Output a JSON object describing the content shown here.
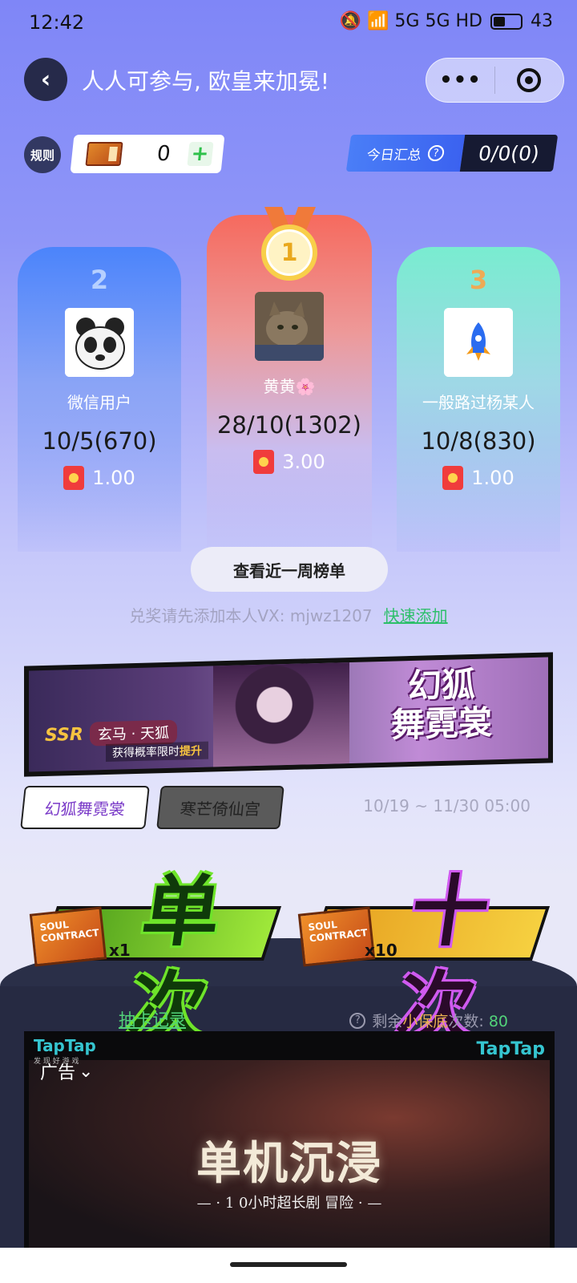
{
  "status_bar": {
    "time": "12:42",
    "indicators": "🔕 📶 5G 5G HD",
    "battery": "43"
  },
  "header": {
    "back_icon": "chevron-left-icon",
    "title": "人人可参与, 欧皇来加冕!",
    "more_icon": "more-dots-icon",
    "close_icon": "target-circle-icon",
    "more_glyph": "•••"
  },
  "toolbar": {
    "rules_label": "规则",
    "ticket_count": "0",
    "add_label": "+",
    "summary_label": "今日汇总",
    "summary_help": "?",
    "summary_value": "0/0(0)"
  },
  "podium": {
    "first": {
      "rank": "1",
      "name": "黄黄🌸",
      "score": "28/10(1302)",
      "prize": "3.00"
    },
    "second": {
      "rank": "2",
      "name": "微信用户",
      "score": "10/5(670)",
      "prize": "1.00"
    },
    "third": {
      "rank": "3",
      "name": "一般路过杨某人",
      "score": "10/8(830)",
      "prize": "1.00"
    }
  },
  "week_button": "查看近一周榜单",
  "contact": {
    "text": "兑奖请先添加本人VX: mjwz1207",
    "link": "快速添加"
  },
  "banner": {
    "title_line1": "幻狐",
    "title_line2": "舞霓裳",
    "ssr": "SSR",
    "character": "玄马 · 天狐",
    "sub_prefix": "获得概率限时",
    "sub_highlight": "提升"
  },
  "pools": {
    "tabs": [
      "幻狐舞霓裳",
      "寒芒倚仙宫"
    ],
    "active_index": 0,
    "time_range": "10/19 ~ 11/30 05:00"
  },
  "draw": {
    "single": {
      "ticket_text": "SOUL CONTRACT",
      "multiplier": "x1",
      "label": "单次"
    },
    "ten": {
      "ticket_text": "SOUL CONTRACT",
      "multiplier": "x10",
      "label": "十次"
    }
  },
  "records_link": "抽卡记录",
  "remaining": {
    "prefix": "剩余",
    "highlight": "小保底",
    "suffix": "次数: ",
    "count": "80"
  },
  "ad": {
    "logo": "TapTap",
    "logo_sub": "发 现 好 游 戏",
    "label": "广告",
    "headline": "单机沉浸",
    "subline": "— · 1 0小时超长剧 冒险 · —"
  },
  "colors": {
    "accent_green": "#52d37a",
    "header_bg": "#7f86f7",
    "first_card": "#f66a5e",
    "second_card": "#4b84fb",
    "third_card": "#79ecd0"
  }
}
